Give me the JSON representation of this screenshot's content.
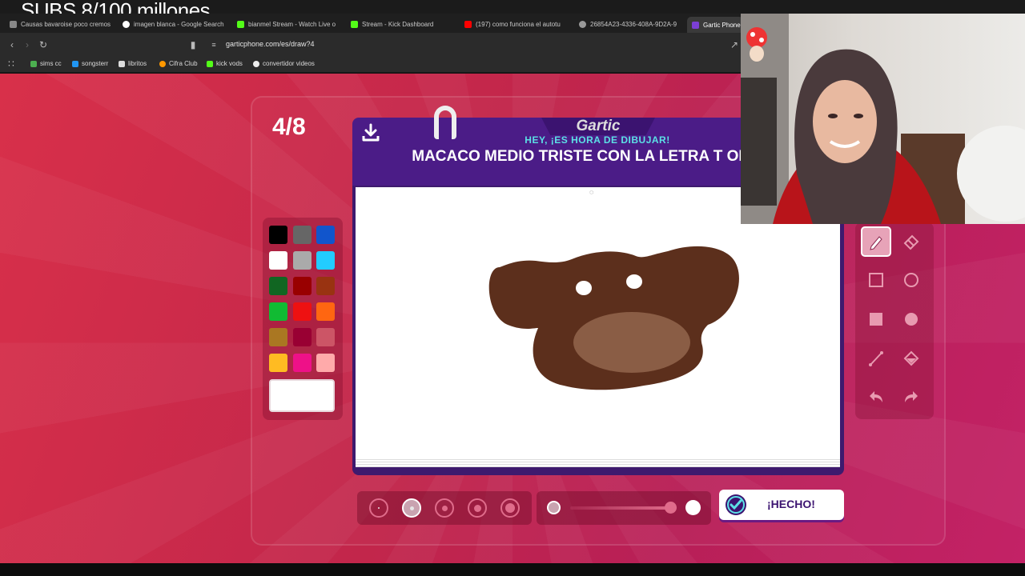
{
  "overlay": {
    "subs_text": "SUBS 8/100 millones"
  },
  "browser": {
    "tabs": [
      {
        "label": "Causas bavaroise poco cremos",
        "icon": "gear-icon"
      },
      {
        "label": "imagen blanca - Google Search",
        "icon": "google-icon"
      },
      {
        "label": "bianmel Stream - Watch Live o",
        "icon": "kick-icon"
      },
      {
        "label": "Stream - Kick Dashboard",
        "icon": "kick-icon"
      },
      {
        "label": "(197) como funciona el autotu",
        "icon": "youtube-icon"
      },
      {
        "label": "26854A23-4336-408A-9D2A-9",
        "icon": "globe-icon"
      },
      {
        "label": "Gartic Phone",
        "icon": "gartic-icon"
      }
    ],
    "url": "garticphone.com/es/draw?4",
    "bookmarks": [
      {
        "label": "sims cc"
      },
      {
        "label": "songsterr"
      },
      {
        "label": "libritos"
      },
      {
        "label": "Cifra Club"
      },
      {
        "label": "kick vods"
      },
      {
        "label": "convertidor videos"
      }
    ]
  },
  "game": {
    "round": "4/8",
    "logo": "Gartic",
    "tagline": "HEY, ¡ES HORA DE DIBUJAR!",
    "prompt": "MACACO MEDIO TRISTE CON LA LETRA T OREJAS",
    "done_label": "¡HECHO!",
    "palette": [
      "#000000",
      "#666666",
      "#1155cc",
      "#ffffff",
      "#aaaaaa",
      "#22ccff",
      "#116622",
      "#990000",
      "#993311",
      "#11bb33",
      "#ee1111",
      "#ff6611",
      "#aa7722",
      "#990033",
      "#cc5566",
      "#ffbb22",
      "#ee1188",
      "#ffaaaa"
    ],
    "current_color": "#ffffff",
    "selected_tool": "pencil",
    "selected_brush_size_index": 1
  }
}
